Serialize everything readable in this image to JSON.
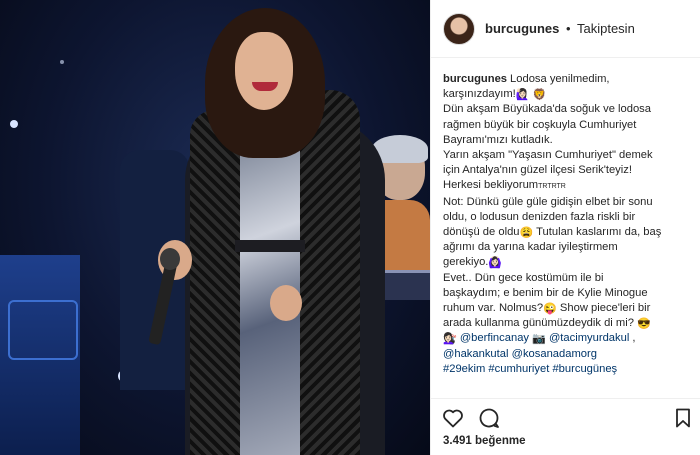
{
  "post": {
    "username": "burcugunes",
    "separator": "•",
    "follow_status": "Takiptesin",
    "likes_count": "3.491",
    "likes_label": "beğenme"
  },
  "caption": {
    "l1_text": "Lodosa yenilmedim,",
    "l2_text": "karşınızdayım!",
    "l2_emoji": "🙋🏻‍♀️ 🦁",
    "l3": "Dün akşam Büyükada'da soğuk ve lodosa",
    "l4": "rağmen büyük bir coşkuyla Cumhuriyet",
    "l5": "Bayramı'mızı kutladık.",
    "l6": "Yarın akşam \"Yaşasın Cumhuriyet\" demek",
    "l7": "için Antalya'nın güzel ilçesi Serik'teyiz!",
    "l8": "Herkesi bekliyorum",
    "l8_small": "TRTRTR",
    "l9": "Not: Dünkü güle güle gidişin elbet bir sonu",
    "l10": "oldu, o lodusun denizden fazla riskli bir",
    "l11_a": "dönüşü de oldu",
    "l11_emoji": "😩",
    "l11_b": "Tutulan kaslarımı da, baş",
    "l12": "ağrımı da yarına kadar iyileştirmem",
    "l13": "gerekiyo.",
    "l13_emoji": "🙆🏻‍♀️",
    "l14": "Evet.. Dün gece kostümüm ile bi",
    "l15": "başkaydım; e benim bir de Kylie Minogue",
    "l16_a": "ruhum var. Nolmus?",
    "l16_emoji": "😜",
    "l16_b": "Show piece'leri bir",
    "l17": "arada kullanma günümüzdeydik di mi?",
    "l17_emoji": "😎",
    "l18_emoji_a": "💇🏻‍♀️",
    "l18_m1": "@berfincanay",
    "l18_emoji_b": "📷",
    "l18_m2": "@tacimyurdakul",
    "l18_comma": ",",
    "l19_m1": "@hakankutal",
    "l19_m2": "@kosanadamorg",
    "l20_t1": "#29ekim",
    "l20_t2": "#cumhuriyet",
    "l20_t3": "#burcugüneş"
  },
  "icons": {
    "like": "heart-icon",
    "comment": "comment-icon",
    "save": "bookmark-icon"
  },
  "colors": {
    "text": "#262626",
    "link": "#003569",
    "border": "#efefef"
  }
}
